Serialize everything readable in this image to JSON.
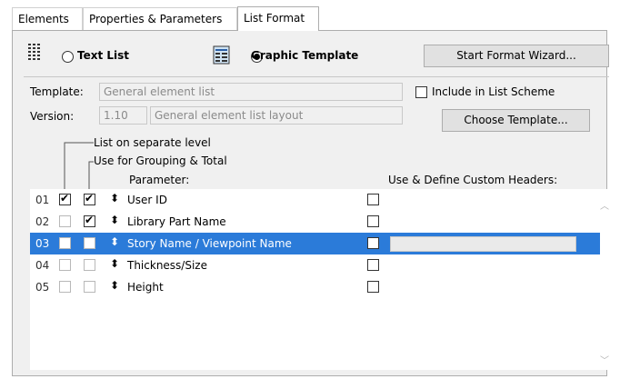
{
  "tabs": [
    {
      "label": "Elements",
      "active": false
    },
    {
      "label": "Properties & Parameters",
      "active": false
    },
    {
      "label": "List Format",
      "active": true
    }
  ],
  "format": {
    "text_list_label": "Text List",
    "text_list_selected": false,
    "graphic_template_label": "Graphic Template",
    "graphic_template_selected": true,
    "wizard_button": "Start Format Wizard..."
  },
  "template": {
    "template_label": "Template:",
    "template_value": "General element list",
    "version_label": "Version:",
    "version_number": "1.10",
    "version_desc": "General element list layout",
    "include_label": "Include in List Scheme",
    "include_checked": false,
    "choose_button": "Choose Template..."
  },
  "legend": {
    "separate_level": "List on separate level",
    "grouping_total": "Use for Grouping & Total",
    "parameter": "Parameter:",
    "custom_headers": "Use & Define Custom Headers:"
  },
  "rows": [
    {
      "num": "01",
      "separate": true,
      "grouping": true,
      "name": "User ID",
      "custom": false,
      "selected": false
    },
    {
      "num": "02",
      "separate": false,
      "grouping": true,
      "name": "Library Part Name",
      "custom": false,
      "selected": false
    },
    {
      "num": "03",
      "separate": false,
      "grouping": false,
      "name": "Story Name / Viewpoint Name",
      "custom": false,
      "selected": true
    },
    {
      "num": "04",
      "separate": false,
      "grouping": false,
      "name": "Thickness/Size",
      "custom": false,
      "selected": false
    },
    {
      "num": "05",
      "separate": false,
      "grouping": false,
      "name": "Height",
      "custom": false,
      "selected": false
    }
  ],
  "colors": {
    "selection": "#2b7bd9"
  }
}
